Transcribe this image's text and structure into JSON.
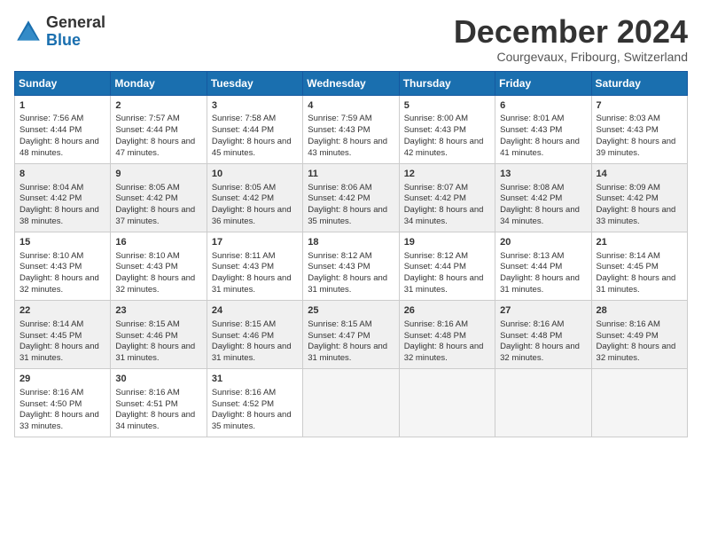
{
  "logo": {
    "general": "General",
    "blue": "Blue"
  },
  "title": "December 2024",
  "location": "Courgevaux, Fribourg, Switzerland",
  "headers": [
    "Sunday",
    "Monday",
    "Tuesday",
    "Wednesday",
    "Thursday",
    "Friday",
    "Saturday"
  ],
  "weeks": [
    [
      {
        "day": "1",
        "sunrise": "Sunrise: 7:56 AM",
        "sunset": "Sunset: 4:44 PM",
        "daylight": "Daylight: 8 hours and 48 minutes."
      },
      {
        "day": "2",
        "sunrise": "Sunrise: 7:57 AM",
        "sunset": "Sunset: 4:44 PM",
        "daylight": "Daylight: 8 hours and 47 minutes."
      },
      {
        "day": "3",
        "sunrise": "Sunrise: 7:58 AM",
        "sunset": "Sunset: 4:44 PM",
        "daylight": "Daylight: 8 hours and 45 minutes."
      },
      {
        "day": "4",
        "sunrise": "Sunrise: 7:59 AM",
        "sunset": "Sunset: 4:43 PM",
        "daylight": "Daylight: 8 hours and 43 minutes."
      },
      {
        "day": "5",
        "sunrise": "Sunrise: 8:00 AM",
        "sunset": "Sunset: 4:43 PM",
        "daylight": "Daylight: 8 hours and 42 minutes."
      },
      {
        "day": "6",
        "sunrise": "Sunrise: 8:01 AM",
        "sunset": "Sunset: 4:43 PM",
        "daylight": "Daylight: 8 hours and 41 minutes."
      },
      {
        "day": "7",
        "sunrise": "Sunrise: 8:03 AM",
        "sunset": "Sunset: 4:43 PM",
        "daylight": "Daylight: 8 hours and 39 minutes."
      }
    ],
    [
      {
        "day": "8",
        "sunrise": "Sunrise: 8:04 AM",
        "sunset": "Sunset: 4:42 PM",
        "daylight": "Daylight: 8 hours and 38 minutes."
      },
      {
        "day": "9",
        "sunrise": "Sunrise: 8:05 AM",
        "sunset": "Sunset: 4:42 PM",
        "daylight": "Daylight: 8 hours and 37 minutes."
      },
      {
        "day": "10",
        "sunrise": "Sunrise: 8:05 AM",
        "sunset": "Sunset: 4:42 PM",
        "daylight": "Daylight: 8 hours and 36 minutes."
      },
      {
        "day": "11",
        "sunrise": "Sunrise: 8:06 AM",
        "sunset": "Sunset: 4:42 PM",
        "daylight": "Daylight: 8 hours and 35 minutes."
      },
      {
        "day": "12",
        "sunrise": "Sunrise: 8:07 AM",
        "sunset": "Sunset: 4:42 PM",
        "daylight": "Daylight: 8 hours and 34 minutes."
      },
      {
        "day": "13",
        "sunrise": "Sunrise: 8:08 AM",
        "sunset": "Sunset: 4:42 PM",
        "daylight": "Daylight: 8 hours and 34 minutes."
      },
      {
        "day": "14",
        "sunrise": "Sunrise: 8:09 AM",
        "sunset": "Sunset: 4:42 PM",
        "daylight": "Daylight: 8 hours and 33 minutes."
      }
    ],
    [
      {
        "day": "15",
        "sunrise": "Sunrise: 8:10 AM",
        "sunset": "Sunset: 4:43 PM",
        "daylight": "Daylight: 8 hours and 32 minutes."
      },
      {
        "day": "16",
        "sunrise": "Sunrise: 8:10 AM",
        "sunset": "Sunset: 4:43 PM",
        "daylight": "Daylight: 8 hours and 32 minutes."
      },
      {
        "day": "17",
        "sunrise": "Sunrise: 8:11 AM",
        "sunset": "Sunset: 4:43 PM",
        "daylight": "Daylight: 8 hours and 31 minutes."
      },
      {
        "day": "18",
        "sunrise": "Sunrise: 8:12 AM",
        "sunset": "Sunset: 4:43 PM",
        "daylight": "Daylight: 8 hours and 31 minutes."
      },
      {
        "day": "19",
        "sunrise": "Sunrise: 8:12 AM",
        "sunset": "Sunset: 4:44 PM",
        "daylight": "Daylight: 8 hours and 31 minutes."
      },
      {
        "day": "20",
        "sunrise": "Sunrise: 8:13 AM",
        "sunset": "Sunset: 4:44 PM",
        "daylight": "Daylight: 8 hours and 31 minutes."
      },
      {
        "day": "21",
        "sunrise": "Sunrise: 8:14 AM",
        "sunset": "Sunset: 4:45 PM",
        "daylight": "Daylight: 8 hours and 31 minutes."
      }
    ],
    [
      {
        "day": "22",
        "sunrise": "Sunrise: 8:14 AM",
        "sunset": "Sunset: 4:45 PM",
        "daylight": "Daylight: 8 hours and 31 minutes."
      },
      {
        "day": "23",
        "sunrise": "Sunrise: 8:15 AM",
        "sunset": "Sunset: 4:46 PM",
        "daylight": "Daylight: 8 hours and 31 minutes."
      },
      {
        "day": "24",
        "sunrise": "Sunrise: 8:15 AM",
        "sunset": "Sunset: 4:46 PM",
        "daylight": "Daylight: 8 hours and 31 minutes."
      },
      {
        "day": "25",
        "sunrise": "Sunrise: 8:15 AM",
        "sunset": "Sunset: 4:47 PM",
        "daylight": "Daylight: 8 hours and 31 minutes."
      },
      {
        "day": "26",
        "sunrise": "Sunrise: 8:16 AM",
        "sunset": "Sunset: 4:48 PM",
        "daylight": "Daylight: 8 hours and 32 minutes."
      },
      {
        "day": "27",
        "sunrise": "Sunrise: 8:16 AM",
        "sunset": "Sunset: 4:48 PM",
        "daylight": "Daylight: 8 hours and 32 minutes."
      },
      {
        "day": "28",
        "sunrise": "Sunrise: 8:16 AM",
        "sunset": "Sunset: 4:49 PM",
        "daylight": "Daylight: 8 hours and 32 minutes."
      }
    ],
    [
      {
        "day": "29",
        "sunrise": "Sunrise: 8:16 AM",
        "sunset": "Sunset: 4:50 PM",
        "daylight": "Daylight: 8 hours and 33 minutes."
      },
      {
        "day": "30",
        "sunrise": "Sunrise: 8:16 AM",
        "sunset": "Sunset: 4:51 PM",
        "daylight": "Daylight: 8 hours and 34 minutes."
      },
      {
        "day": "31",
        "sunrise": "Sunrise: 8:16 AM",
        "sunset": "Sunset: 4:52 PM",
        "daylight": "Daylight: 8 hours and 35 minutes."
      },
      null,
      null,
      null,
      null
    ]
  ]
}
